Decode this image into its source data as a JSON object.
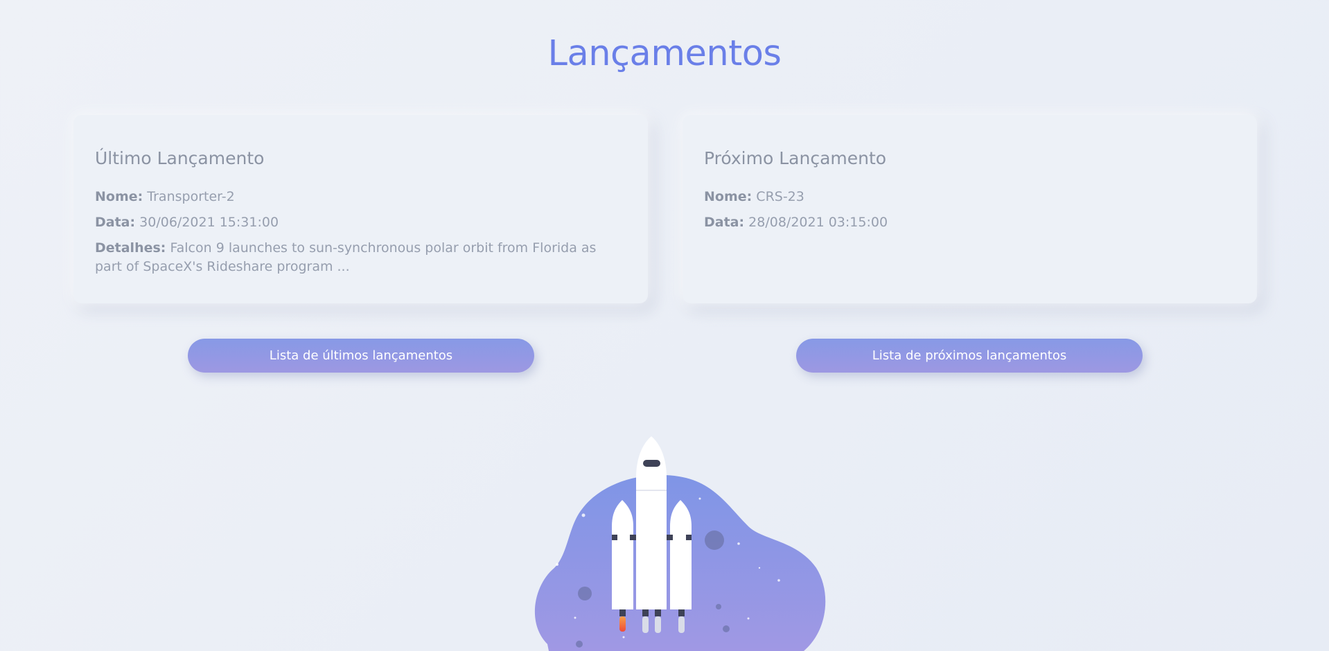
{
  "page": {
    "title": "Lançamentos"
  },
  "last_launch": {
    "title": "Último Lançamento",
    "name_label": "Nome:",
    "name_value": "Transporter-2",
    "date_label": "Data:",
    "date_value": "30/06/2021 15:31:00",
    "details_label": "Detalhes:",
    "details_value": "Falcon 9 launches to sun-synchronous polar orbit from Florida as part of SpaceX's Rideshare program ..."
  },
  "next_launch": {
    "title": "Próximo Lançamento",
    "name_label": "Nome:",
    "name_value": "CRS-23",
    "date_label": "Data:",
    "date_value": "28/08/2021 03:15:00"
  },
  "buttons": {
    "past_list": "Lista de últimos lançamentos",
    "upcoming_list": "Lista de próximos lançamentos"
  },
  "illustration": {
    "icon": "rocket-launch-illustration",
    "colors": {
      "blob_top": "#7f95e6",
      "blob_bottom": "#a098e4",
      "rocket": "#ffffff",
      "flame": "#f0543c"
    }
  },
  "colors": {
    "accent": "#6a7fe8",
    "background": "#eaeef5",
    "card": "#edf1f7",
    "text": "#8e96a6"
  }
}
